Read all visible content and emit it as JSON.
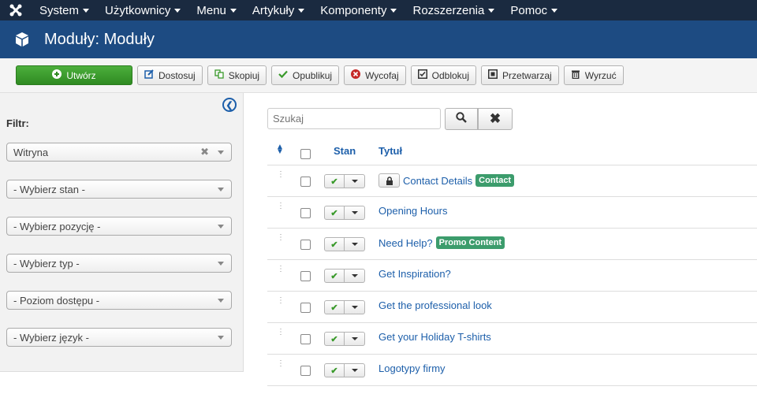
{
  "nav": {
    "items": [
      "System",
      "Użytkownicy",
      "Menu",
      "Artykuły",
      "Komponenty",
      "Rozszerzenia",
      "Pomoc"
    ]
  },
  "header": {
    "title": "Moduły: Moduły"
  },
  "toolbar": {
    "create": "Utwórz",
    "customize": "Dostosuj",
    "copy": "Skopiuj",
    "publish": "Opublikuj",
    "unpublish": "Wycofaj",
    "unlock": "Odblokuj",
    "batch": "Przetwarzaj",
    "trash": "Wyrzuć"
  },
  "sidebar": {
    "filter_label": "Filtr:",
    "selects": [
      "Witryna",
      "- Wybierz stan -",
      "- Wybierz pozycję -",
      "- Wybierz typ -",
      "- Poziom dostępu -",
      "- Wybierz język -"
    ]
  },
  "search": {
    "placeholder": "Szukaj"
  },
  "table": {
    "col_state": "Stan",
    "col_title": "Tytuł",
    "rows": [
      {
        "title": "Contact Details",
        "badge": "Contact",
        "locked": true
      },
      {
        "title": "Opening Hours"
      },
      {
        "title": "Need Help?",
        "badge": "Promo Content"
      },
      {
        "title": "Get Inspiration?"
      },
      {
        "title": "Get the professional look"
      },
      {
        "title": "Get your Holiday T-shirts"
      },
      {
        "title": "Logotypy firmy"
      }
    ]
  },
  "colors": {
    "nav_bg": "#1a2a40",
    "header_bg": "#1d4b82",
    "primary_green": "#2f8a22",
    "link_blue": "#1d5faa",
    "badge_green": "#3c9c6c"
  }
}
